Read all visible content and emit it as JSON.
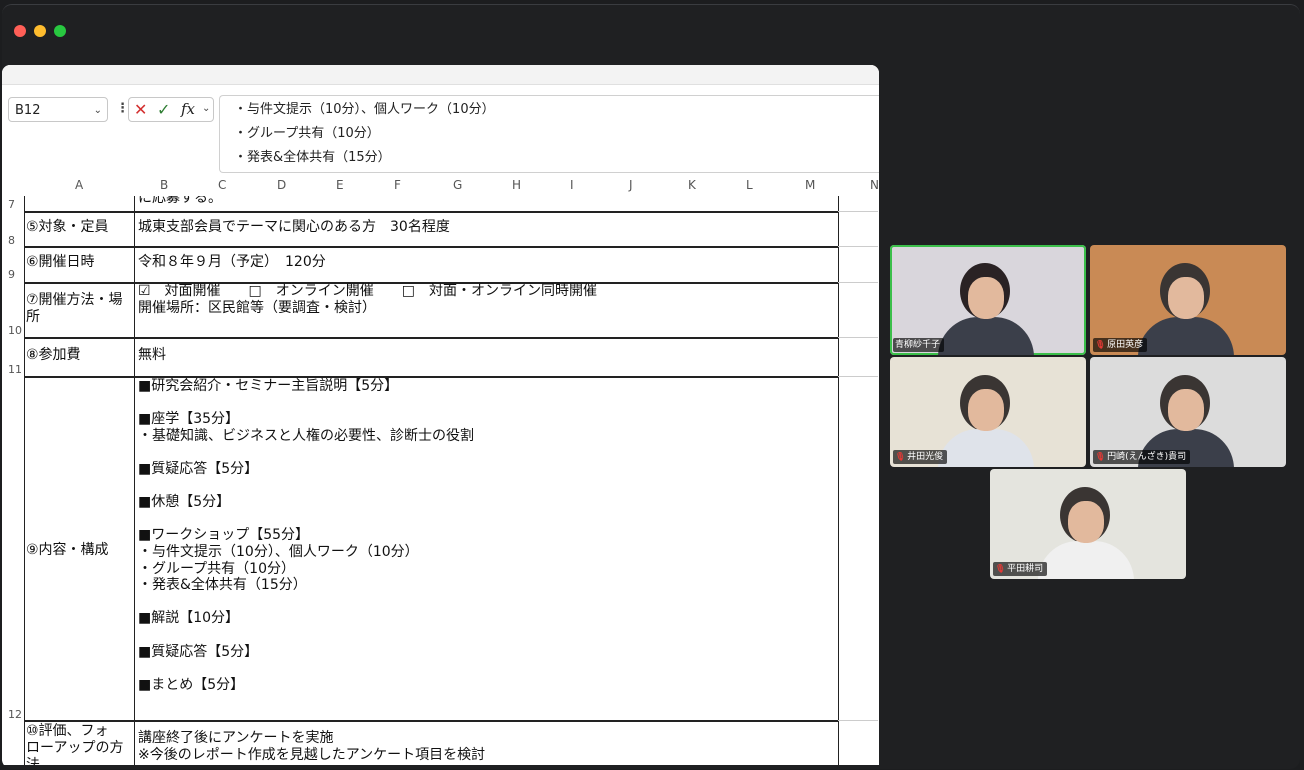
{
  "window": {
    "traffic_colors": [
      "#ff5f57",
      "#febc2e",
      "#28c840"
    ]
  },
  "excel": {
    "name_box": "B12",
    "fx_label": "fx",
    "cancel_glyph": "✕",
    "confirm_glyph": "✓",
    "formula_lines": [
      "・与件文提示（10分）、個人ワーク（10分）",
      "・グループ共有（10分）",
      "・発表&全体共有（15分）"
    ],
    "columns": [
      "A",
      "B",
      "C",
      "D",
      "E",
      "F",
      "G",
      "H",
      "I",
      "J",
      "K",
      "L",
      "M",
      "N"
    ],
    "rows": [
      {
        "num": "7",
        "a": "",
        "b": "に応募する。"
      },
      {
        "num": "8",
        "a": "⑤対象・定員",
        "b": "城東支部会員でテーマに関心のある方　30名程度"
      },
      {
        "num": "9",
        "a": "⑥開催日時",
        "b": "令和８年９月（予定）　120分"
      },
      {
        "num": "10",
        "a": "⑦開催方法・場\n所",
        "b": "☑　対面開催　　□　オンライン開催　　□　対面・オンライン同時開催\n開催場所：区民館等（要調査・検討）"
      },
      {
        "num": "11",
        "a": "⑧参加費",
        "b": "無料"
      },
      {
        "num": "12",
        "a": "⑨内容・構成",
        "b": "■研究会紹介・セミナー主旨説明【5分】\n\n■座学【35分】\n・基礎知識、ビジネスと人権の必要性、診断士の役割\n\n■質疑応答【5分】\n\n■休憩【5分】\n\n■ワークショップ【55分】\n・与件文提示（10分）、個人ワーク（10分）\n・グループ共有（10分）\n・発表&全体共有（15分）\n\n■解説【10分】\n\n■質疑応答【5分】\n\n■まとめ【5分】"
      },
      {
        "num": "",
        "a": "⑩評価、フォ\nローアップの方\n法",
        "b": "講座終了後にアンケートを実施\n※今後のレポート作成を見越したアンケート項目を検討"
      }
    ]
  },
  "participants": [
    {
      "name": "青柳紗千子",
      "active": true,
      "bg": "#d9d6dc"
    },
    {
      "name": "原田英彦",
      "active": false,
      "bg": "#c98a55"
    },
    {
      "name": "井田光俊",
      "active": false,
      "bg": "#e7e2d6"
    },
    {
      "name": "円崎(えんざき)貴司",
      "active": false,
      "bg": "#dcdcdc"
    },
    {
      "name": "平田耕司",
      "active": false,
      "bg": "#e4e4de"
    }
  ],
  "colors": {
    "active_border": "#3bbf4a",
    "excel_border": "#222222"
  }
}
